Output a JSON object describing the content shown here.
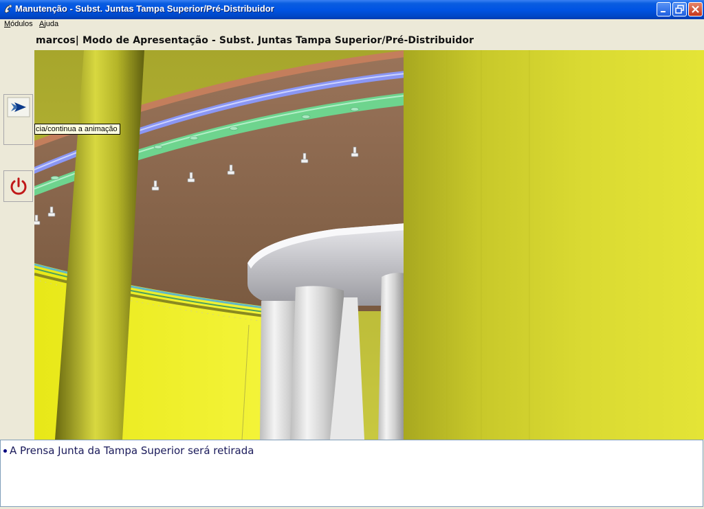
{
  "window": {
    "title": "Manutenção - Subst. Juntas Tampa Superior/Pré-Distribuidor"
  },
  "menu": {
    "items": [
      {
        "label": "Módulos",
        "accel": "M",
        "rest": "ódulos"
      },
      {
        "label": "Ajuda",
        "accel": "A",
        "rest": "juda"
      }
    ]
  },
  "toolbar": {
    "play_icon": "play-arrow-icon",
    "power_icon": "power-icon",
    "tooltip": "cia/continua a animação"
  },
  "scene": {
    "header": "marcos| Modo de Apresentação - Subst. Juntas Tampa Superior/Pré-Distribuidor"
  },
  "info": {
    "lines": [
      "A Prensa Junta da Tampa Superior será retirada"
    ]
  },
  "colors": {
    "title_bar": "#0054e3",
    "yellow": "#e2e030",
    "brown_cover": "#8a6a4a",
    "green_ring": "#6ad890",
    "blue_ring": "#7a8af0"
  }
}
